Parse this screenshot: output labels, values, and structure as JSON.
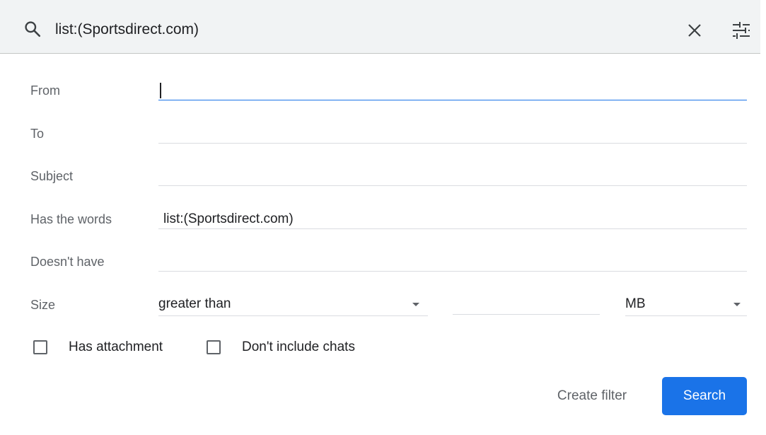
{
  "search_bar": {
    "query": "list:(Sportsdirect.com)",
    "icons": {
      "search": "search-icon",
      "clear": "close-icon",
      "options": "tune-icon"
    }
  },
  "form": {
    "from": {
      "label": "From",
      "value": ""
    },
    "to": {
      "label": "To",
      "value": ""
    },
    "subject": {
      "label": "Subject",
      "value": ""
    },
    "has_words": {
      "label": "Has the words",
      "value": "list:(Sportsdirect.com)"
    },
    "doesnt_have": {
      "label": "Doesn't have",
      "value": ""
    },
    "size": {
      "label": "Size",
      "comparator": "greater than",
      "value": "",
      "unit": "MB"
    },
    "has_attachment": {
      "label": "Has attachment",
      "checked": false
    },
    "exclude_chats": {
      "label": "Don't include chats",
      "checked": false
    }
  },
  "actions": {
    "create_filter": "Create filter",
    "search": "Search"
  },
  "colors": {
    "topbar_bg": "#f1f3f4",
    "accent": "#1a73e8",
    "label": "#5f6368"
  }
}
